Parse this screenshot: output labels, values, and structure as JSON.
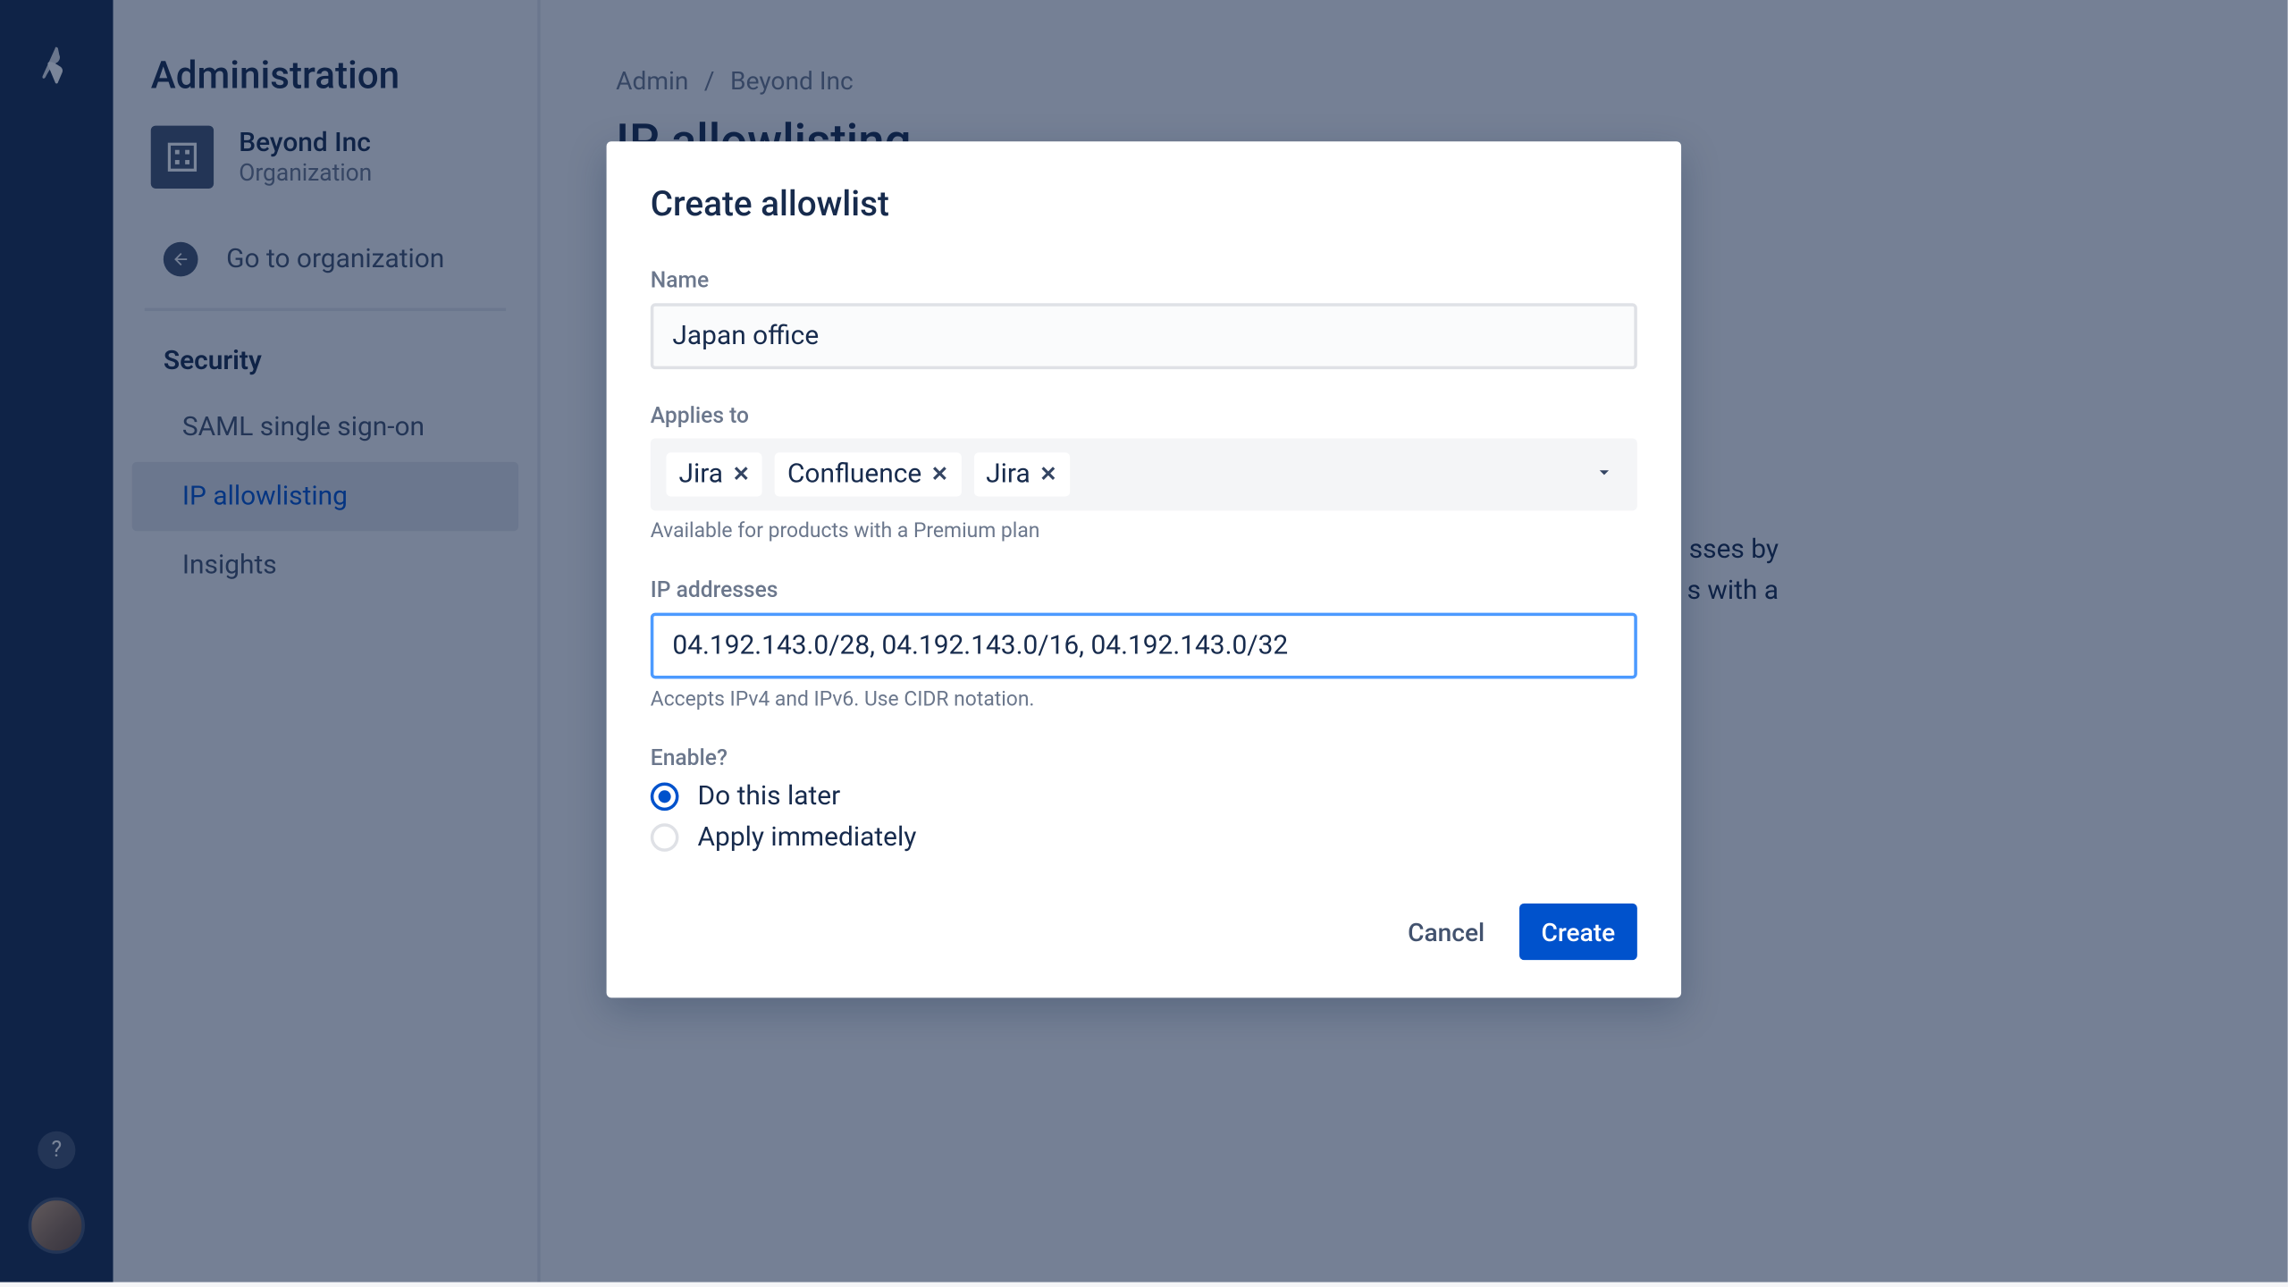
{
  "sidebar": {
    "title": "Administration",
    "org": {
      "name": "Beyond Inc",
      "subtitle": "Organization"
    },
    "go_to_org": "Go to organization",
    "section_title": "Security",
    "items": [
      {
        "label": "SAML single sign-on"
      },
      {
        "label": "IP allowlisting"
      },
      {
        "label": "Insights"
      }
    ]
  },
  "breadcrumbs": {
    "admin": "Admin",
    "org": "Beyond Inc"
  },
  "page": {
    "title": "IP allowlisting",
    "body_part1": "sses by",
    "body_part2": "s with a"
  },
  "modal": {
    "title": "Create allowlist",
    "name_label": "Name",
    "name_value": "Japan office",
    "applies_label": "Applies to",
    "applies_chips": [
      "Jira",
      "Confluence",
      "Jira"
    ],
    "applies_help": "Available for products with a Premium plan",
    "ip_label": "IP addresses",
    "ip_value": "04.192.143.0/28, 04.192.143.0/16, 04.192.143.0/32",
    "ip_help": "Accepts IPv4 and IPv6. Use CIDR notation.",
    "enable_label": "Enable?",
    "enable_options": [
      "Do this later",
      "Apply immediately"
    ],
    "cancel": "Cancel",
    "create": "Create"
  }
}
